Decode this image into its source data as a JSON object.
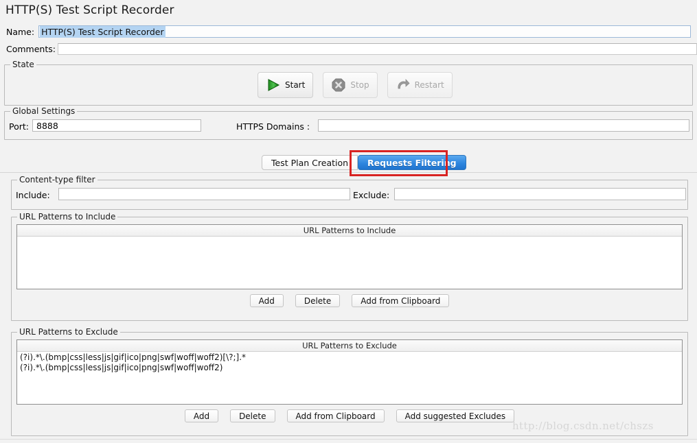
{
  "window": {
    "title": "HTTP(S) Test Script Recorder"
  },
  "name_field": {
    "label": "Name:",
    "value": "HTTP(S) Test Script Recorder"
  },
  "comments_field": {
    "label": "Comments:",
    "value": ""
  },
  "state": {
    "title": "State",
    "buttons": [
      {
        "label": "Start",
        "icon": "play-triangle-icon",
        "enabled": true
      },
      {
        "label": "Stop",
        "icon": "stop-octagon-icon",
        "enabled": false
      },
      {
        "label": "Restart",
        "icon": "restart-arrow-icon",
        "enabled": false
      }
    ]
  },
  "global_settings": {
    "title": "Global Settings",
    "port_label": "Port:",
    "port_value": "8888",
    "https_label": "HTTPS Domains :",
    "https_value": ""
  },
  "tabs": {
    "items": [
      {
        "label": "Test Plan Creation",
        "active": false
      },
      {
        "label": "Requests Filtering",
        "active": true
      }
    ],
    "annotation_color": "#d82322"
  },
  "content_type_filter": {
    "title": "Content-type filter",
    "include_label": "Include:",
    "include_value": "",
    "exclude_label": "Exclude:",
    "exclude_value": ""
  },
  "url_include": {
    "title": "URL Patterns to Include",
    "column_header": "URL Patterns to Include",
    "rows": [],
    "buttons": [
      "Add",
      "Delete",
      "Add from Clipboard"
    ]
  },
  "url_exclude": {
    "title": "URL Patterns to Exclude",
    "column_header": "URL Patterns to Exclude",
    "rows": [
      "(?i).*\\.(bmp|css|less|js|gif|ico|png|swf|woff|woff2)[\\?;].*",
      "(?i).*\\.(bmp|css|less|js|gif|ico|png|swf|woff|woff2)"
    ],
    "buttons": [
      "Add",
      "Delete",
      "Add from Clipboard",
      "Add suggested Excludes"
    ]
  },
  "watermark": {
    "text": "http://blog.csdn.net/chszs"
  },
  "colors": {
    "background": "#f2f2f2",
    "tab_active": "#2e86df",
    "selection": "#b4d4f2",
    "annotation": "#d82322"
  }
}
